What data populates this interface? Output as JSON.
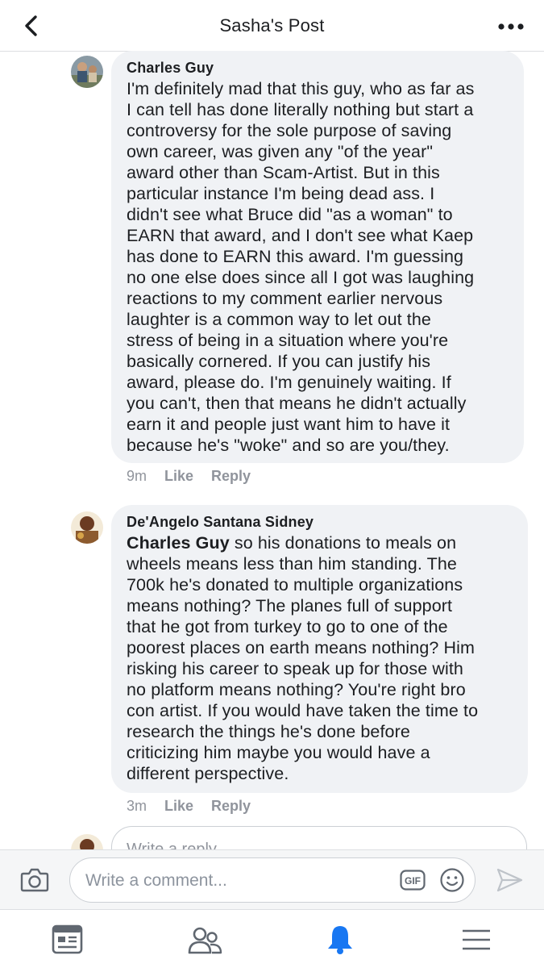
{
  "header": {
    "title": "Sasha's Post"
  },
  "comments": [
    {
      "author": "Charles Guy",
      "mention": "",
      "text": "I'm definitely mad that this guy, who as far as\nI can tell has done literally nothing but start a\ncontroversy for the sole purpose of saving\nown career, was given any \"of the year\"\naward other than Scam-Artist. But in this\nparticular instance I'm being dead ass. I\ndidn't see what Bruce did \"as a woman\" to\nEARN that award, and I don't see what Kaep\nhas done to EARN this award. I'm guessing\nno one else does since all I got was laughing\nreactions to my comment earlier nervous\nlaughter is a common way to let out the\nstress of being in a situation where you're\nbasically cornered. If you can justify his\naward, please do. I'm genuinely waiting. If\nyou can't, then that means he didn't actually\nearn it and people just want him to have it\nbecause he's \"woke\" and so are you/they.",
      "time": "9m",
      "like": "Like",
      "reply": "Reply"
    },
    {
      "author": "De'Angelo Santana Sidney",
      "mention": "Charles Guy",
      "text": " so his donations to meals on\nwheels means less than him standing. The\n700k he's donated to multiple organizations\nmeans nothing? The planes full of support\nthat he got from turkey to go to one of the\npoorest places on earth means nothing? Him\nrisking his career to speak up for those with\nno platform means nothing? You're right bro\ncon artist. If you would have taken the time to\nresearch the things he's done before\ncriticizing him maybe you would have a\ndifferent perspective.",
      "time": "3m",
      "like": "Like",
      "reply": "Reply"
    }
  ],
  "reply_box": {
    "placeholder": "Write a reply..."
  },
  "composer": {
    "placeholder": "Write a comment...",
    "gif_label": "GIF"
  },
  "tabs": [
    {
      "name": "news-feed",
      "icon": "news-feed-icon",
      "active": false
    },
    {
      "name": "friends",
      "icon": "friends-icon",
      "active": false
    },
    {
      "name": "notifications",
      "icon": "bell-icon",
      "active": true
    },
    {
      "name": "menu",
      "icon": "hamburger-menu-icon",
      "active": false
    }
  ],
  "colors": {
    "accent": "#1877f2",
    "bubble": "#f0f2f5",
    "meta_text": "#90949c"
  }
}
